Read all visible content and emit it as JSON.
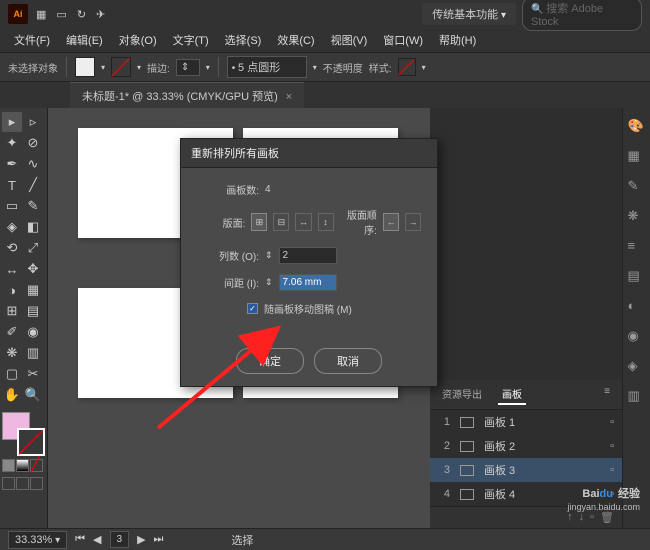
{
  "title": {
    "workspace": "传统基本功能",
    "search_placeholder": "搜索 Adobe Stock"
  },
  "menu": [
    "文件(F)",
    "编辑(E)",
    "对象(O)",
    "文字(T)",
    "选择(S)",
    "效果(C)",
    "视图(V)",
    "窗口(W)",
    "帮助(H)"
  ],
  "optbar": {
    "noselect": "未选择对象",
    "stroke_label": "描边:",
    "stroke_val": "5 点圆形",
    "opacity_label": "不透明度",
    "style_label": "样式:"
  },
  "doc": {
    "tab": "未标题-1* @ 33.33% (CMYK/GPU 预览)",
    "close": "×"
  },
  "dialog": {
    "title": "重新排列所有画板",
    "count_label": "画板数:",
    "count_val": "4",
    "layout_label": "版面:",
    "order_label": "版面顺序:",
    "cols_label": "列数 (O):",
    "cols_val": "2",
    "spacing_label": "间距 (I):",
    "spacing_val": "7.06 mm",
    "move_art": "随画板移动图稿 (M)",
    "ok": "确定",
    "cancel": "取消"
  },
  "panel": {
    "tab1": "资源导出",
    "tab2": "画板",
    "items": [
      {
        "n": "1",
        "name": "画板 1"
      },
      {
        "n": "2",
        "name": "画板 2"
      },
      {
        "n": "3",
        "name": "画板 3"
      },
      {
        "n": "4",
        "name": "画板 4"
      }
    ]
  },
  "status": {
    "zoom": "33.33%",
    "nav": "3",
    "mode": "选择"
  },
  "watermark": {
    "brand": "Bai",
    "brand2": "du",
    "suffix": "经验",
    "url": "jingyan.baidu.com"
  }
}
